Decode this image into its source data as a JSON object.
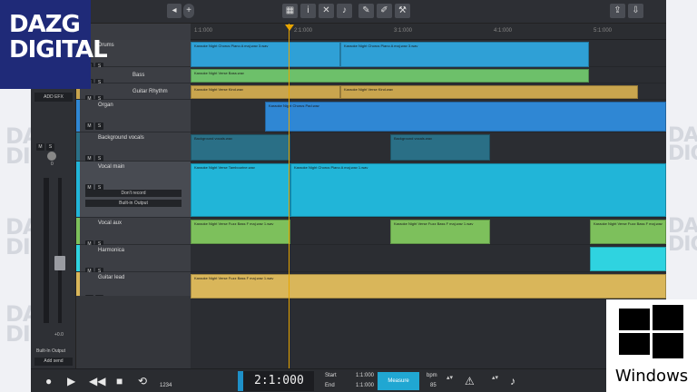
{
  "watermark": {
    "brand_line1": "DAZG",
    "brand_line2": "DIGITAL",
    "badge_text": "Windows"
  },
  "toolbar": {
    "icons": [
      "grid-icon",
      "info-icon",
      "settings-icon",
      "metronome-icon",
      "pen-icon",
      "edit-icon",
      "wrench-icon",
      "upload-icon",
      "download-icon"
    ]
  },
  "mixer": {
    "add_fx_label": "ADD EFX",
    "pan_value": "0",
    "volume_value": "+0.0",
    "output_label": "Built-In Output",
    "add_send_label": "Add send"
  },
  "tracks": [
    {
      "name": "Drums",
      "color": "#2fa0d6"
    },
    {
      "name": "Bass",
      "color": "#6dc06a"
    },
    {
      "name": "Guitar Rhythm",
      "color": "#c9a54e"
    },
    {
      "name": "Organ",
      "color": "#2f87d4"
    },
    {
      "name": "Background vocals",
      "color": "#2a6f86"
    },
    {
      "name": "Vocal main",
      "color": "#21b5d8",
      "record_label": "Don't record",
      "output_label": "Built-in Output"
    },
    {
      "name": "Vocal aux",
      "color": "#7dc05c"
    },
    {
      "name": "Harmonica",
      "color": "#2fd3e0"
    },
    {
      "name": "Guitar lead",
      "color": "#d9b65a"
    }
  ],
  "track_buttons": {
    "mute": "M",
    "solo": "S"
  },
  "ruler": {
    "marks": [
      "1:1:000",
      "2:1:000",
      "3:1:000",
      "4:1:000",
      "5:1:000"
    ]
  },
  "clips": [
    {
      "label": "Karaoke Night Chorus Piano A maj.wav 3.wav"
    },
    {
      "label": "Karaoke Night Chorus Piano A maj.wav 3.wav"
    },
    {
      "label": "Karaoke Night Verse Bass.wav"
    },
    {
      "label": "Karaoke Night Verse Kind.wav"
    },
    {
      "label": "Karaoke Night Verse Kind.wav"
    },
    {
      "label": "Karaoke Night Chorus Pad.wav"
    },
    {
      "label": "Background vocals.wav"
    },
    {
      "label": "Background vocals.wav"
    },
    {
      "label": "Karaoke Night Verse Tambourine.wav"
    },
    {
      "label": "Karaoke Night Chorus Piano A maj.wav 1.wav"
    },
    {
      "label": "Karaoke Night Verse Fuzz Bass F maj.wav 1.wav"
    },
    {
      "label": "Karaoke Night Verse Fuzz Bass F maj.wav 1.wav"
    },
    {
      "label": "Karaoke Night Verse Fuzz Bass F maj.wav"
    },
    {
      "label": "Karaoke Night Verse Fuzz Bass F maj.wav 1.wav"
    }
  ],
  "transport": {
    "position": "2:1:000",
    "start_label": "Start",
    "start_value": "1:1:000",
    "end_label": "End",
    "end_value": "1:1:000",
    "mode_label": "Measure",
    "tempo_label": "bpm",
    "tempo_value": "85",
    "time_sig": "1234"
  }
}
